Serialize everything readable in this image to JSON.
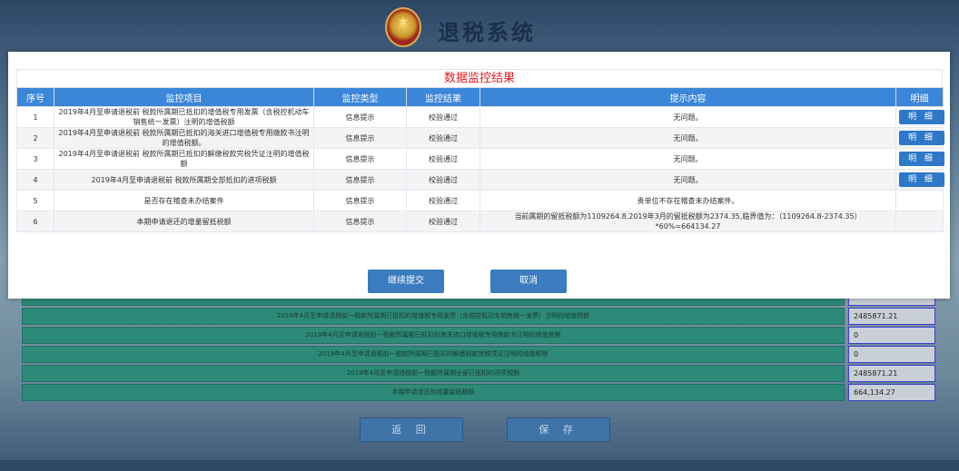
{
  "app": {
    "title": "退税系统"
  },
  "modal": {
    "title": "数据监控结果",
    "columns": [
      "序号",
      "监控项目",
      "监控类型",
      "监控结果",
      "提示内容",
      "明细"
    ],
    "rows": [
      {
        "no": "1",
        "item": "2019年4月至申请退税前 税款所属期已抵扣的增值税专用发票（含税控机动车销售统一发票）注明的增值税额",
        "type": "信息提示",
        "result": "校验通过",
        "tip": "无问题。",
        "detail": "明 细"
      },
      {
        "no": "2",
        "item": "2019年4月至申请退税前 税款所属期已抵扣的海关进口增值税专用缴款书注明的增值税额。",
        "type": "信息提示",
        "result": "校验通过",
        "tip": "无问题。",
        "detail": "明 细"
      },
      {
        "no": "3",
        "item": "2019年4月至申请退税前 税款所属期已抵扣的解缴税款完税凭证注明的增值税额",
        "type": "信息提示",
        "result": "校验通过",
        "tip": "无问题。",
        "detail": "明 细"
      },
      {
        "no": "4",
        "item": "2019年4月至申请退税前 税款所属期全部抵扣的进项税额",
        "type": "信息提示",
        "result": "校验通过",
        "tip": "无问题。",
        "detail": "明 细"
      },
      {
        "no": "5",
        "item": "是否存在稽查未办结案件",
        "type": "信息提示",
        "result": "校验通过",
        "tip": "贵单位不存在稽查未办结案件。",
        "detail": ""
      },
      {
        "no": "6",
        "item": "本期申请退还的增量留抵税额",
        "type": "信息提示",
        "result": "校验通过",
        "tip": "当前属期的留抵税额为1109264.8,2019年3月的留抵税额为2374.35,临界值为：（1109264.8-2374.35）*60%=664134.27",
        "detail": ""
      }
    ],
    "continue_label": "继续提交",
    "cancel_label": "取消"
  },
  "background_table": {
    "rows": [
      {
        "label": "",
        "value": ""
      },
      {
        "label": "2019年4月至申请退税前一税款所属期已抵扣的增值税专用发票（含税控机动车销售统一发票）注明的增值税额",
        "value": "2485871.21"
      },
      {
        "label": "2019年4月至申请退税前一税款所属期已抵扣的海关进口增值税专用缴款书注明的增值税额",
        "value": "0"
      },
      {
        "label": "2019年4月至申请退税前一税款所属期已抵扣的解缴税款完税凭证注明的增值税额",
        "value": "0"
      },
      {
        "label": "2019年4月至申请退税前一税款所属期全部已抵扣的进项税额",
        "value": "2485871.21"
      },
      {
        "label": "本期申请退还的增量留抵税额",
        "value": "664,134.27"
      }
    ],
    "back_label": "返 回",
    "save_label": "保 存"
  }
}
